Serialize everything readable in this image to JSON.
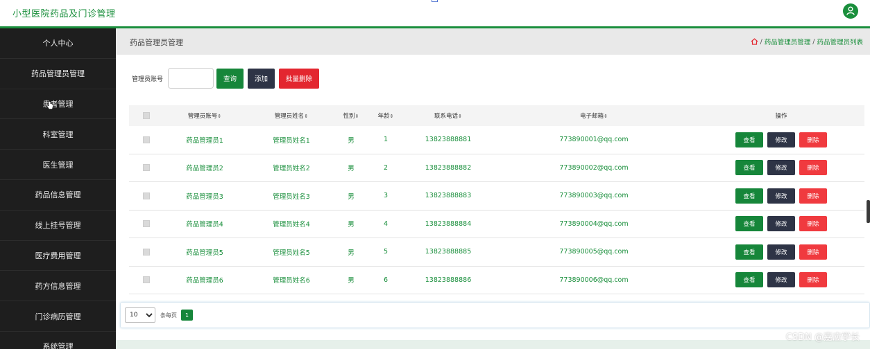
{
  "header": {
    "title": "小型医院药品及门诊管理"
  },
  "sidebar": {
    "items": [
      {
        "label": "个人中心"
      },
      {
        "label": "药品管理员管理"
      },
      {
        "label": "患者管理"
      },
      {
        "label": "科室管理"
      },
      {
        "label": "医生管理"
      },
      {
        "label": "药品信息管理"
      },
      {
        "label": "线上挂号管理"
      },
      {
        "label": "医疗费用管理"
      },
      {
        "label": "药方信息管理"
      },
      {
        "label": "门诊病历管理"
      },
      {
        "label": "系统管理"
      }
    ]
  },
  "page": {
    "title": "药品管理员管理",
    "breadcrumb": [
      "药品管理员管理",
      "药品管理员列表"
    ],
    "breadcrumb_sep": "/"
  },
  "search": {
    "label": "管理员账号",
    "value": "",
    "query_label": "查询",
    "add_label": "添加",
    "batch_delete_label": "批量删除"
  },
  "table": {
    "columns": [
      "管理员账号",
      "管理员姓名",
      "性别",
      "年龄",
      "联系电话",
      "电子邮箱",
      "操作"
    ],
    "rows": [
      [
        "药品管理员1",
        "管理员姓名1",
        "男",
        "1",
        "13823888881",
        "773890001@qq.com"
      ],
      [
        "药品管理员2",
        "管理员姓名2",
        "男",
        "2",
        "13823888882",
        "773890002@qq.com"
      ],
      [
        "药品管理员3",
        "管理员姓名3",
        "男",
        "3",
        "13823888883",
        "773890003@qq.com"
      ],
      [
        "药品管理员4",
        "管理员姓名4",
        "男",
        "4",
        "13823888884",
        "773890004@qq.com"
      ],
      [
        "药品管理员5",
        "管理员姓名5",
        "男",
        "5",
        "13823888885",
        "773890005@qq.com"
      ],
      [
        "药品管理员6",
        "管理员姓名6",
        "男",
        "6",
        "13823888886",
        "773890006@qq.com"
      ]
    ],
    "actions": {
      "view": "查看",
      "edit": "修改",
      "delete": "删除"
    },
    "sort_glyph": "⇕"
  },
  "pagination": {
    "page_size": "10",
    "page_size_options": [
      "10"
    ],
    "per_page_label": "条每页",
    "current_page": "1"
  },
  "watermark": "CSDN @嘉应学长",
  "colors": {
    "primary_green": "#1a8f3c",
    "sidebar_bg": "#1e1e1e",
    "dark_button": "#2e3446",
    "danger_red": "#e3262f"
  }
}
